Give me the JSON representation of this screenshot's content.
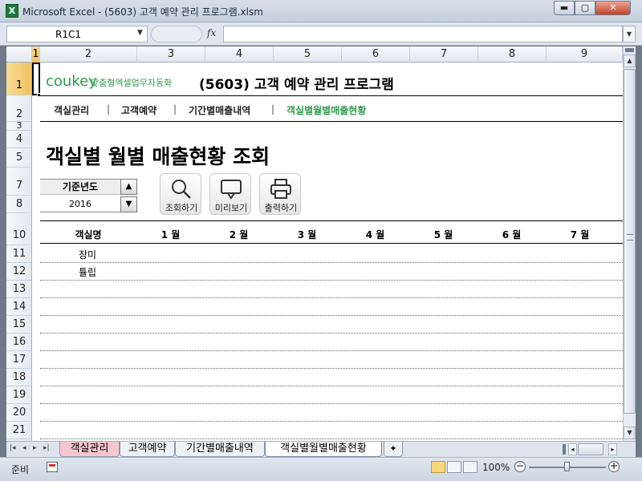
{
  "window": {
    "title": "Microsoft Excel - (5603) 고객 예약 관리 프로그램.xlsm",
    "app_icon": "excel-icon",
    "min_label": "▬",
    "max_label": "▢",
    "close_label": "✕"
  },
  "formula_bar": {
    "name_box": "R1C1",
    "fx_label": "fx",
    "formula": ""
  },
  "columns": [
    "1",
    "2",
    "3",
    "4",
    "5",
    "6",
    "7",
    "8",
    "9"
  ],
  "rows": [
    "1",
    "2",
    "3",
    "4",
    "5",
    "7",
    "8",
    "10",
    "11",
    "12",
    "13",
    "14",
    "15",
    "16",
    "17",
    "18",
    "19",
    "20",
    "21"
  ],
  "header": {
    "logo": "coukey",
    "logo_tagline": "맞춤형엑셀업무자동화",
    "title": "(5603) 고객 예약 관리 프로그램"
  },
  "nav": {
    "items": [
      "객실관리",
      "고객예약",
      "기간별매출내역",
      "객실별월별매출현황"
    ],
    "separator": "|",
    "active_color": "#2f9c4b"
  },
  "page": {
    "heading": "객실별 월별 매출현황 조회"
  },
  "controls": {
    "year_label": "기준년도",
    "year_value": "2016",
    "spin_up": "▲",
    "spin_down": "▼",
    "buttons": [
      {
        "label": "조회하기",
        "icon": "search-icon"
      },
      {
        "label": "미리보기",
        "icon": "monitor-icon"
      },
      {
        "label": "출력하기",
        "icon": "printer-icon"
      }
    ]
  },
  "table": {
    "headers": [
      "객실명",
      "1 월",
      "2 월",
      "3 월",
      "4 월",
      "5 월",
      "6 월",
      "7 월"
    ],
    "rows": [
      "장미",
      "튤립"
    ]
  },
  "sheet_tabs": {
    "nav": [
      "|◂",
      "◂",
      "▸",
      "▸|"
    ],
    "tabs": [
      "객실관리",
      "고객예약",
      "기간별매출내역",
      "객실별월별매출현황"
    ],
    "active_index": 3
  },
  "status_bar": {
    "status": "준비",
    "zoom": "100%",
    "zoom_minus": "−",
    "zoom_plus": "+"
  }
}
